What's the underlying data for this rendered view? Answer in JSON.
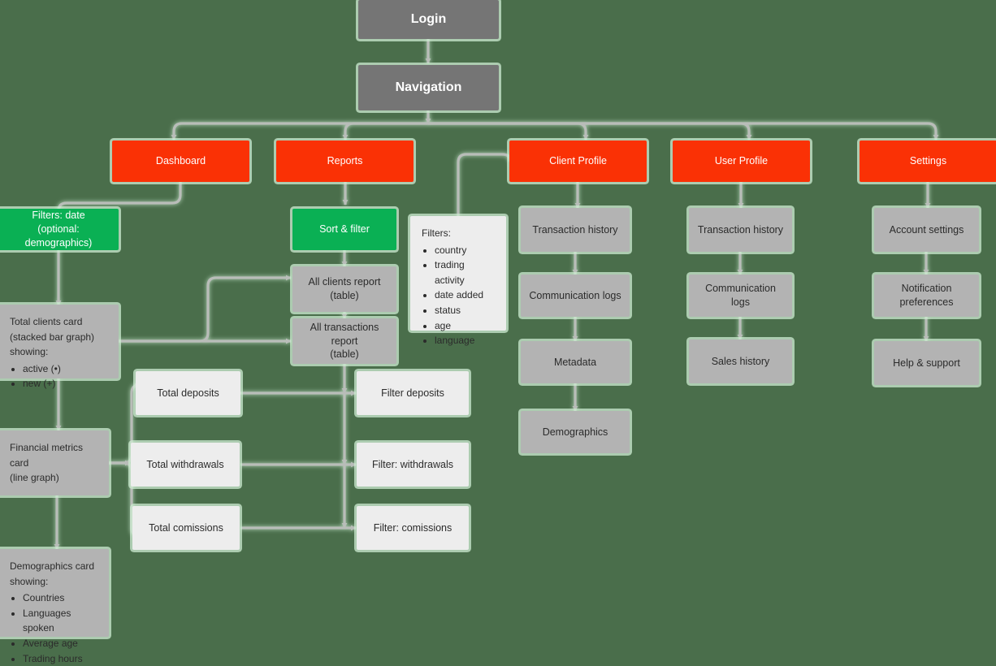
{
  "diagram": {
    "title": "Application site map",
    "background_color": "#4a6e4b",
    "edge_color": "#b9bdb9",
    "edge_glow_color": "#cdecd2",
    "palette": {
      "entry": "#757575",
      "primary_nav": "#fa3105",
      "action": "#0ab054",
      "section": "#b3b3b3",
      "leaf": "#ededed",
      "text_light": "#ffffff",
      "text_dark": "#2b2b2b"
    }
  },
  "nodes": {
    "login": {
      "label": "Login"
    },
    "navigation": {
      "label": "Navigation"
    },
    "dashboard": {
      "label": "Dashboard"
    },
    "reports": {
      "label": "Reports"
    },
    "client_profile": {
      "label": "Client Profile"
    },
    "user_profile": {
      "label": "User Profile"
    },
    "settings": {
      "label": "Settings"
    },
    "filters_date": {
      "label": "Filters: date\n(optional: demographics)"
    },
    "total_clients_card": {
      "heading": "Total clients card\n(stacked bar graph)\nshowing:",
      "items": [
        "active (•)",
        "new (+)"
      ]
    },
    "financial_metrics_card": {
      "label": "Financial metrics card\n(line graph)"
    },
    "demographics_card": {
      "heading": "Demographics card\nshowing:",
      "items": [
        "Countries",
        "Languages spoken",
        "Average age",
        "Trading hours"
      ]
    },
    "sort_filter": {
      "label": "Sort & filter"
    },
    "all_clients_report": {
      "label": "All clients report (table)"
    },
    "all_transactions_report": {
      "label": "All transactions report\n(table)"
    },
    "filters_list": {
      "heading": "Filters:",
      "items": [
        "country",
        "trading activity",
        "date added",
        "status",
        "age",
        "language"
      ]
    },
    "total_deposits": {
      "label": "Total deposits"
    },
    "total_withdrawals": {
      "label": "Total withdrawals"
    },
    "total_comissions": {
      "label": "Total comissions"
    },
    "filter_deposits": {
      "label": "Filter deposits"
    },
    "filter_withdrawals": {
      "label": "Filter: withdrawals"
    },
    "filter_comissions": {
      "label": "Filter: comissions"
    },
    "client_transaction_history": {
      "label": "Transaction history"
    },
    "client_communication_logs": {
      "label": "Communication logs"
    },
    "client_metadata": {
      "label": "Metadata"
    },
    "client_demographics": {
      "label": "Demographics"
    },
    "user_transaction_history": {
      "label": "Transaction history"
    },
    "user_communication_logs": {
      "label": "Communication logs"
    },
    "user_sales_history": {
      "label": "Sales history"
    },
    "account_settings": {
      "label": "Account settings"
    },
    "notification_preferences": {
      "label": "Notification preferences"
    },
    "help_support": {
      "label": "Help & support"
    }
  }
}
